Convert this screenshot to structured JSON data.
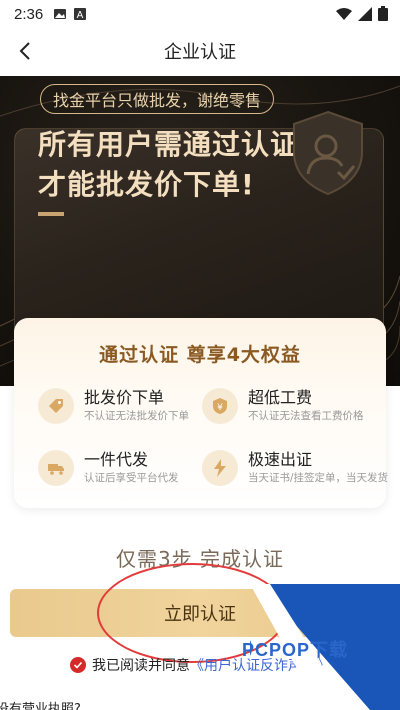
{
  "status_bar": {
    "time": "2:36"
  },
  "nav": {
    "title": "企业认证"
  },
  "hero": {
    "slogan": "找金平台只做批发，谢绝零售",
    "title_line1": "所有用户需通过认证后",
    "title_line2": "才能批发价下单!"
  },
  "benefits": {
    "title": "通过认证 尊享4大权益",
    "items": [
      {
        "title": "批发价下单",
        "desc": "不认证无法批发价下单",
        "icon": "tag-icon"
      },
      {
        "title": "超低工费",
        "desc": "不认证无法查看工费价格",
        "icon": "yen-shield-icon"
      },
      {
        "title": "一件代发",
        "desc": "认证后享受平台代发",
        "icon": "truck-icon"
      },
      {
        "title": "极速出证",
        "desc": "当天证书/挂签定单，当天发货",
        "icon": "lightning-icon"
      }
    ]
  },
  "steps_text": "仅需3步 完成认证",
  "cta_label": "立即认证",
  "agreement": {
    "prefix": "我已阅读并同意",
    "link": "《用户认证反诈声明》"
  },
  "bottom_question": "没有营业执照?",
  "watermark": {
    "text": "PCPOP下载"
  },
  "colors": {
    "gold": "#c9a470",
    "cta": "#f0d49c",
    "link": "#3b66d6",
    "check": "#d62a2a"
  }
}
